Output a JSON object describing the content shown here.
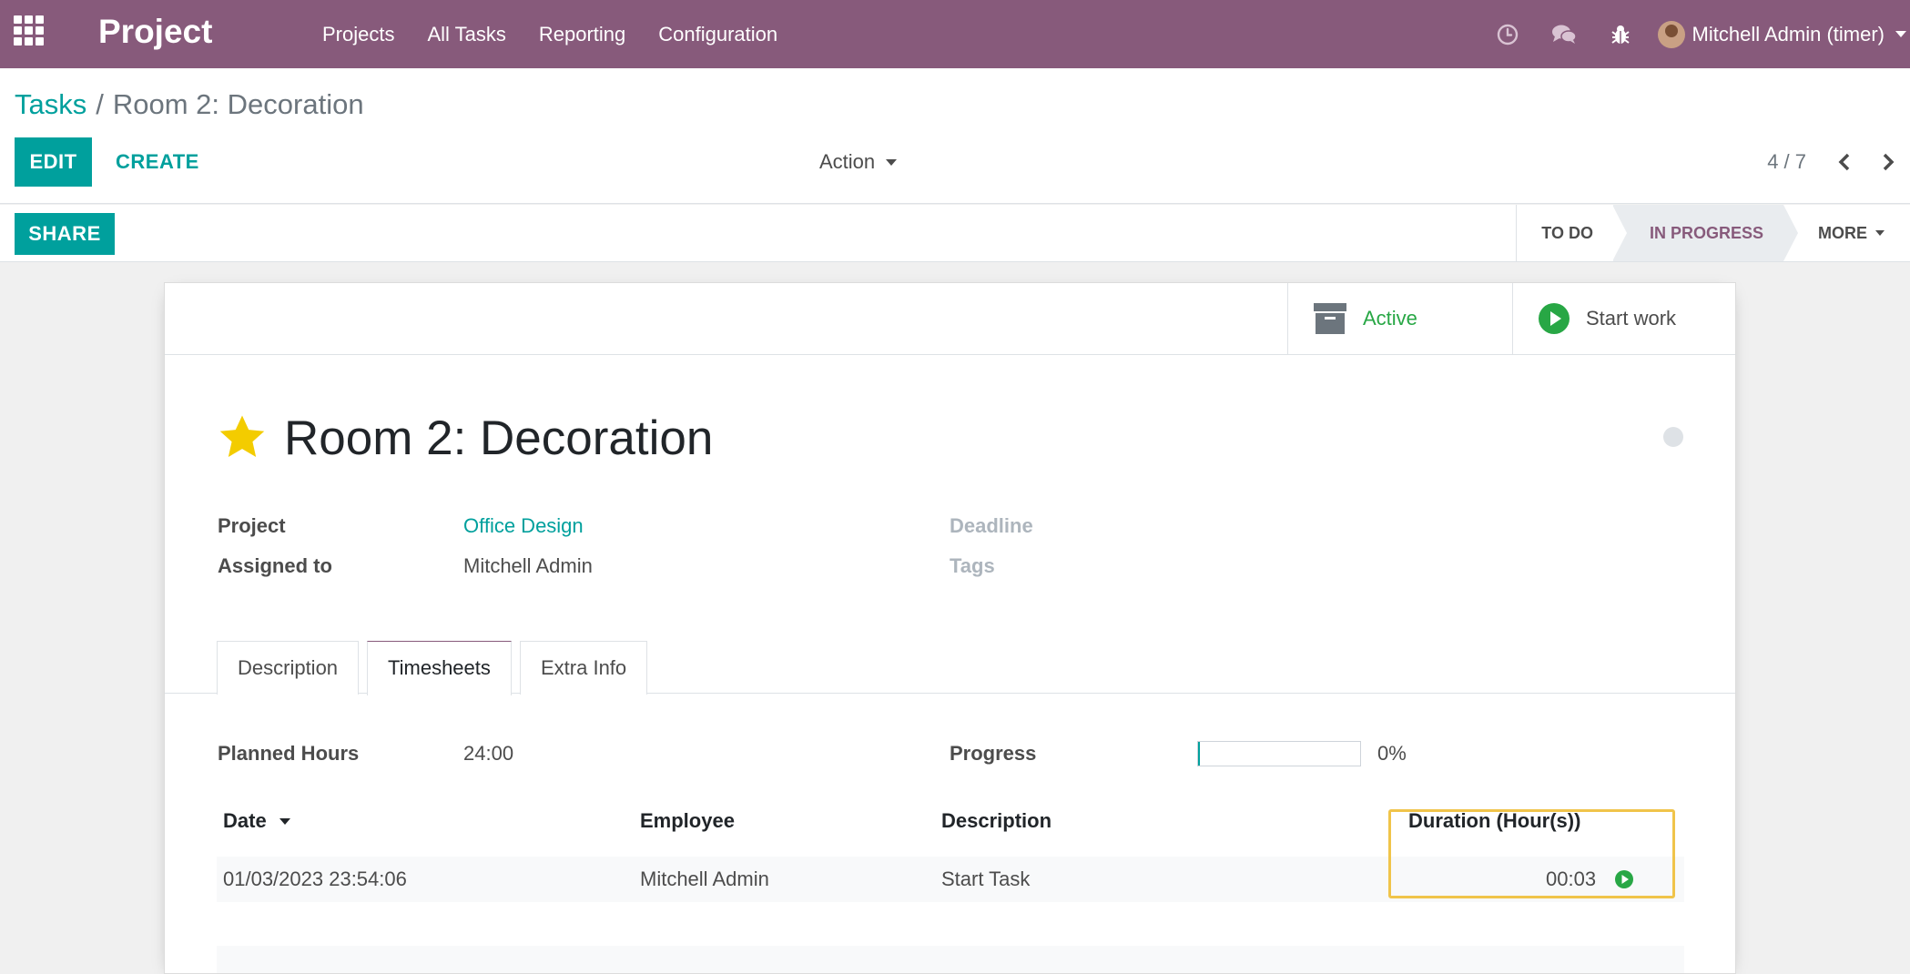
{
  "navbar": {
    "app_name": "Project",
    "menu": [
      "Projects",
      "All Tasks",
      "Reporting",
      "Configuration"
    ],
    "user_name": "Mitchell Admin (timer)",
    "icons": [
      "apps-icon",
      "clock-icon",
      "chat-icon",
      "bug-icon"
    ]
  },
  "breadcrumb": {
    "parent": "Tasks",
    "separator": "/",
    "current": "Room 2: Decoration"
  },
  "toolbar": {
    "edit_label": "EDIT",
    "create_label": "CREATE",
    "action_label": "Action"
  },
  "pager": {
    "value": "4 / 7"
  },
  "statusbar": {
    "share_label": "SHARE",
    "stages": [
      "TO DO",
      "IN PROGRESS"
    ],
    "active_stage": "IN PROGRESS",
    "more_label": "MORE"
  },
  "button_box": {
    "active_label": "Active",
    "start_work_label": "Start work"
  },
  "task": {
    "title": "Room 2: Decoration",
    "starred": true
  },
  "fields": {
    "project_label": "Project",
    "project_value": "Office Design",
    "assigned_label": "Assigned to",
    "assigned_value": "Mitchell Admin",
    "deadline_label": "Deadline",
    "tags_label": "Tags"
  },
  "tabs": [
    "Description",
    "Timesheets",
    "Extra Info"
  ],
  "timesheets": {
    "planned_hours_label": "Planned Hours",
    "planned_hours_value": "24:00",
    "progress_label": "Progress",
    "progress_value": 0,
    "progress_text": "0%",
    "columns": [
      "Date",
      "Employee",
      "Description",
      "Duration (Hour(s))"
    ],
    "rows": [
      {
        "date": "01/03/2023 23:54:06",
        "employee": "Mitchell Admin",
        "description": "Start Task",
        "duration": "00:03"
      }
    ]
  },
  "colors": {
    "brand": "#875a7b",
    "primary": "#00a09d",
    "success": "#28a745",
    "star": "#f3cc00",
    "highlight": "#f0c44a"
  }
}
